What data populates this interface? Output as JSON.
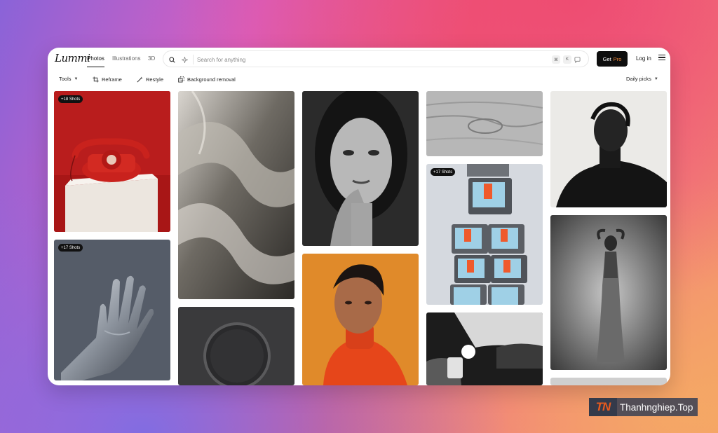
{
  "brand": {
    "logo": "Lummi"
  },
  "nav": {
    "tabs": [
      {
        "label": "Photos",
        "active": true
      },
      {
        "label": "Illustrations",
        "active": false
      },
      {
        "label": "3D",
        "active": false
      }
    ]
  },
  "search": {
    "placeholder": "Search for anything",
    "value": "",
    "shortcut_keys": [
      "⌘",
      "K"
    ]
  },
  "header": {
    "get_label": "Get",
    "pro_label": "Pro",
    "login_label": "Log in"
  },
  "toolbar": {
    "tools_label": "Tools",
    "reframe_label": "Reframe",
    "restyle_label": "Restyle",
    "bg_removal_label": "Background removal",
    "sort_label": "Daily picks"
  },
  "gallery": {
    "badges": {
      "telephone": "+18 Shots",
      "hand": "+17 Shots",
      "tvs": "+17 Shots"
    },
    "tiles": [
      {
        "subject": "red telephone",
        "colors": [
          "#b01818",
          "#e8e2dc"
        ]
      },
      {
        "subject": "silver hand",
        "colors": [
          "#5a6270",
          "#c9cdd3"
        ]
      },
      {
        "subject": "silver fabric",
        "colors": [
          "#3c3a37",
          "#d6d2cb"
        ]
      },
      {
        "subject": "dark round button",
        "colors": [
          "#2d2d2f",
          "#4a4a4c"
        ]
      },
      {
        "subject": "woman portrait bw",
        "colors": [
          "#1c1c1c",
          "#bcbcbc"
        ]
      },
      {
        "subject": "man red turtleneck",
        "colors": [
          "#e0892a",
          "#e8451b"
        ]
      },
      {
        "subject": "wood grain",
        "colors": [
          "#8a8a8a",
          "#d0d0d0"
        ]
      },
      {
        "subject": "stacked tvs",
        "colors": [
          "#d8dbe0",
          "#ef5a2c"
        ]
      },
      {
        "subject": "car street bw",
        "colors": [
          "#111111",
          "#e0e0e0"
        ]
      },
      {
        "subject": "man silhouette",
        "colors": [
          "#111111",
          "#e8e8e6"
        ]
      },
      {
        "subject": "woman dancer bw",
        "colors": [
          "#2a2a2a",
          "#b0b0b0"
        ]
      }
    ]
  },
  "watermark": {
    "logo": "TN",
    "text": "Thanhnghiep.Top"
  },
  "colors": {
    "accent_pro": "#f08a3c",
    "button_dark": "#0e0e0e"
  }
}
